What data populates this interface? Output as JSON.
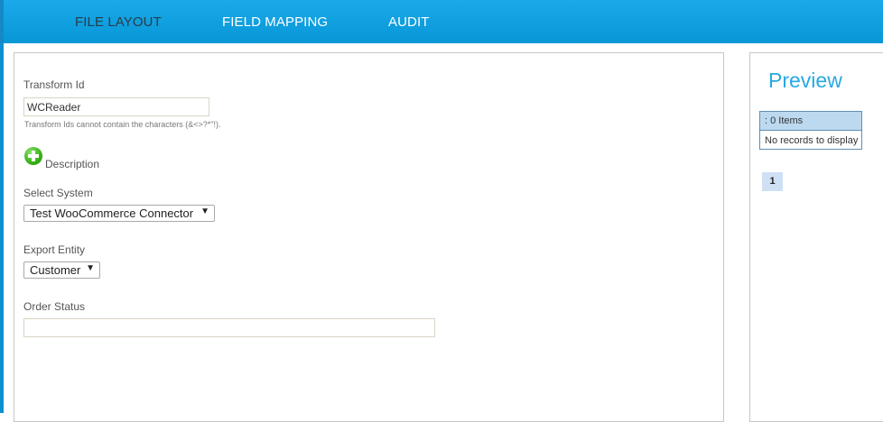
{
  "nav": {
    "tabs": [
      {
        "label": "FILE LAYOUT",
        "active": true
      },
      {
        "label": "FIELD MAPPING",
        "active": false
      },
      {
        "label": "AUDIT",
        "active": false
      }
    ]
  },
  "form": {
    "transform_id": {
      "label": "Transform Id",
      "value": "WCReader",
      "hint": "Transform Ids cannot contain the characters (&<>?*\"!)."
    },
    "description": {
      "label": "Description",
      "icon": "add-icon"
    },
    "select_system": {
      "label": "Select System",
      "value": "Test WooCommerce Connector"
    },
    "export_entity": {
      "label": "Export Entity",
      "value": "Customer"
    },
    "order_status": {
      "label": "Order Status",
      "value": ""
    }
  },
  "preview": {
    "title": "Preview",
    "grid_header": ": 0 Items",
    "empty_message": "No records to display",
    "page": "1"
  },
  "colors": {
    "accent": "#0797d6",
    "preview_title": "#29a8e0",
    "active_tab": "#2a3b48"
  }
}
